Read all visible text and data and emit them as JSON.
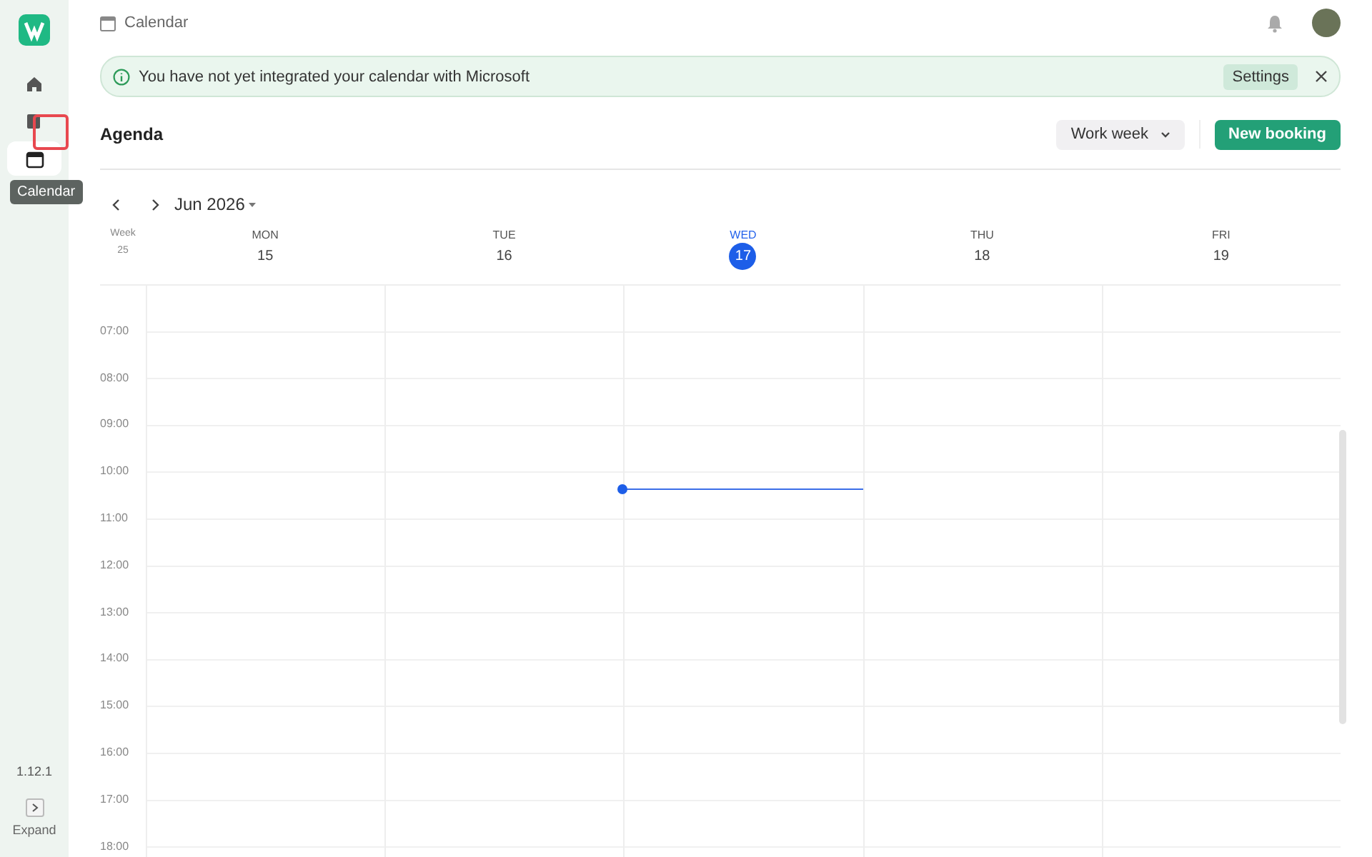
{
  "sidebar": {
    "items": [
      {
        "kind": "home",
        "selected": false
      },
      {
        "kind": "book",
        "selected": false
      },
      {
        "kind": "calendar",
        "selected": true
      }
    ],
    "tooltip": "Calendar",
    "version": "1.12.1",
    "expand_label": "Expand"
  },
  "header": {
    "breadcrumb": "Calendar"
  },
  "banner": {
    "message": "You have not yet integrated your calendar with Microsoft",
    "action": "Settings"
  },
  "toolbar": {
    "title": "Agenda",
    "view": "Work week",
    "primary_button": "New booking"
  },
  "navigator": {
    "month": "Jun 2026"
  },
  "week": {
    "label": "Week",
    "number": "25"
  },
  "days": [
    {
      "name": "MON",
      "date": "15",
      "today": false
    },
    {
      "name": "TUE",
      "date": "16",
      "today": false
    },
    {
      "name": "WED",
      "date": "17",
      "today": true
    },
    {
      "name": "THU",
      "date": "18",
      "today": false
    },
    {
      "name": "FRI",
      "date": "19",
      "today": false
    }
  ],
  "hours": [
    "07:00",
    "08:00",
    "09:00",
    "10:00",
    "11:00",
    "12:00",
    "13:00",
    "14:00",
    "15:00",
    "16:00",
    "17:00",
    "18:00"
  ]
}
